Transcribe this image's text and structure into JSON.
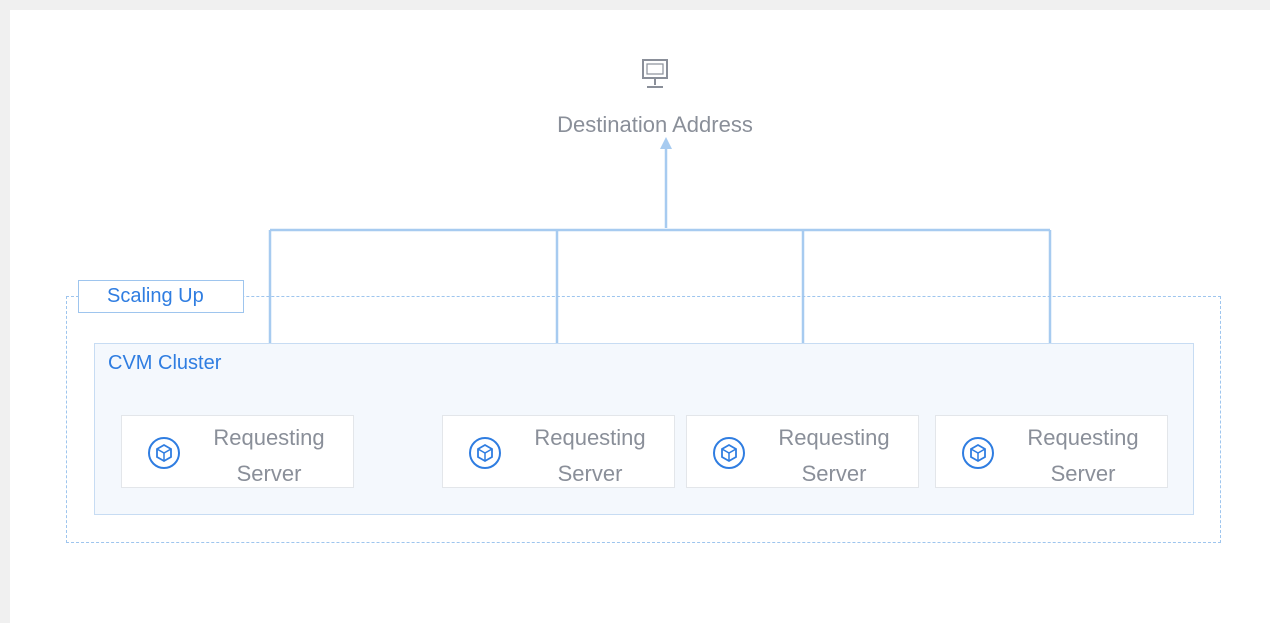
{
  "destination": {
    "icon": "monitor-icon",
    "label": "Destination Address"
  },
  "scaling": {
    "label": "Scaling Up"
  },
  "cluster": {
    "label": "CVM Cluster"
  },
  "servers": [
    {
      "line1": "Requesting",
      "line2": "Server",
      "icon": "cube-icon"
    },
    {
      "line1": "Requesting",
      "line2": "Server",
      "icon": "cube-icon"
    },
    {
      "line1": "Requesting",
      "line2": "Server",
      "icon": "cube-icon"
    },
    {
      "line1": "Requesting",
      "line2": "Server",
      "icon": "cube-icon"
    }
  ],
  "colors": {
    "connector": "#a7cbf0",
    "accent": "#2f7de1",
    "text_muted": "#8a8f99"
  }
}
